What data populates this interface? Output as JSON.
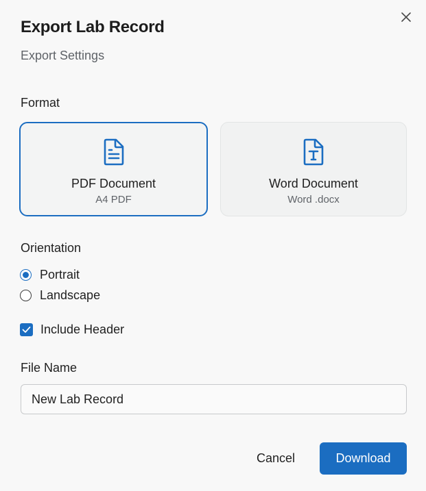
{
  "dialog": {
    "title": "Export Lab Record",
    "subtitle": "Export Settings"
  },
  "format": {
    "label": "Format",
    "options": [
      {
        "title": "PDF Document",
        "subtitle": "A4 PDF",
        "icon": "pdf-document-icon",
        "selected": true
      },
      {
        "title": "Word Document",
        "subtitle": "Word .docx",
        "icon": "word-document-icon",
        "selected": false
      }
    ]
  },
  "orientation": {
    "label": "Orientation",
    "options": [
      {
        "label": "Portrait",
        "checked": true
      },
      {
        "label": "Landscape",
        "checked": false
      }
    ]
  },
  "include_header": {
    "label": "Include Header",
    "checked": true
  },
  "file_name": {
    "label": "File Name",
    "value": "New Lab Record"
  },
  "actions": {
    "cancel_label": "Cancel",
    "download_label": "Download"
  },
  "colors": {
    "accent": "#1b6dc1",
    "background": "#f8f8f8",
    "text_secondary": "#5f6368"
  }
}
